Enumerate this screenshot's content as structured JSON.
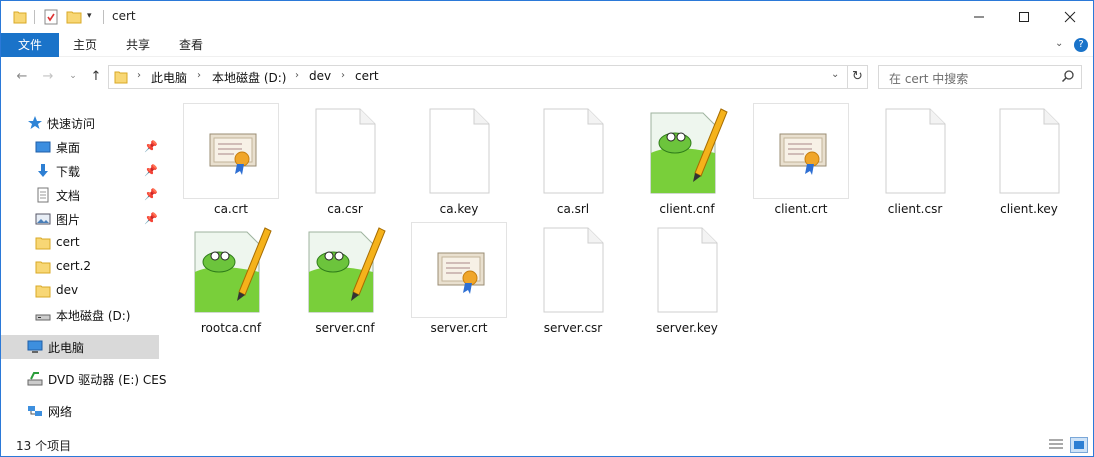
{
  "window": {
    "title": "cert",
    "controls": {
      "minimize_icon": "minimize-icon",
      "maximize_icon": "maximize-icon",
      "close_icon": "close-icon"
    }
  },
  "ribbon": {
    "tabs": [
      {
        "label": "文件",
        "active": true
      },
      {
        "label": "主页"
      },
      {
        "label": "共享"
      },
      {
        "label": "查看"
      }
    ]
  },
  "address": {
    "crumbs": [
      "此电脑",
      "本地磁盘 (D:)",
      "dev",
      "cert"
    ]
  },
  "search": {
    "placeholder": "在 cert 中搜索"
  },
  "nav": {
    "quick_access": "快速访问",
    "items": [
      {
        "label": "桌面",
        "icon": "desktop-icon",
        "pinned": true
      },
      {
        "label": "下载",
        "icon": "download-icon",
        "pinned": true
      },
      {
        "label": "文档",
        "icon": "documents-icon",
        "pinned": true
      },
      {
        "label": "图片",
        "icon": "pictures-icon",
        "pinned": true
      },
      {
        "label": "cert",
        "icon": "folder-icon"
      },
      {
        "label": "cert.2",
        "icon": "folder-icon"
      },
      {
        "label": "dev",
        "icon": "folder-icon"
      },
      {
        "label": "本地磁盘 (D:)",
        "icon": "drive-icon"
      }
    ],
    "this_pc": "此电脑",
    "dvd": "DVD 驱动器 (E:) CES",
    "network": "网络"
  },
  "files": [
    {
      "name": "ca.crt",
      "type": "cert"
    },
    {
      "name": "ca.csr",
      "type": "blank"
    },
    {
      "name": "ca.key",
      "type": "blank"
    },
    {
      "name": "ca.srl",
      "type": "blank"
    },
    {
      "name": "client.cnf",
      "type": "notepad"
    },
    {
      "name": "client.crt",
      "type": "cert"
    },
    {
      "name": "client.csr",
      "type": "blank"
    },
    {
      "name": "client.key",
      "type": "blank"
    },
    {
      "name": "rootca.cnf",
      "type": "notepad"
    },
    {
      "name": "server.cnf",
      "type": "notepad"
    },
    {
      "name": "server.crt",
      "type": "cert"
    },
    {
      "name": "server.csr",
      "type": "blank"
    },
    {
      "name": "server.key",
      "type": "blank"
    }
  ],
  "status": {
    "count": "13 个项目"
  },
  "colors": {
    "accent": "#1a73c9",
    "selection": "#d9d9d9",
    "border": "#2b79d8"
  }
}
